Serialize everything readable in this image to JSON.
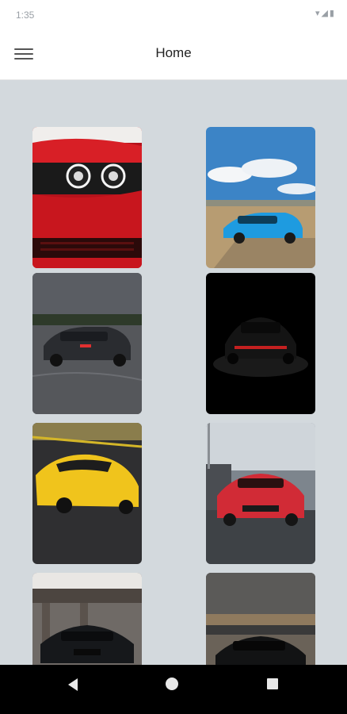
{
  "status_bar": {
    "time": "1:35",
    "icons": "▾◢▮"
  },
  "app_bar": {
    "title": "Home"
  },
  "gallery": {
    "images": [
      {
        "name": "red-car-front"
      },
      {
        "name": "blue-audi-r8"
      },
      {
        "name": "gray-sedan-smoke"
      },
      {
        "name": "black-muscle-car"
      },
      {
        "name": "yellow-supra"
      },
      {
        "name": "red-bmw-m4"
      },
      {
        "name": "black-audi-garage"
      },
      {
        "name": "black-car-sunset"
      }
    ]
  },
  "nav_bar": {
    "back": "back-icon",
    "home": "home-icon",
    "recents": "recents-icon"
  }
}
